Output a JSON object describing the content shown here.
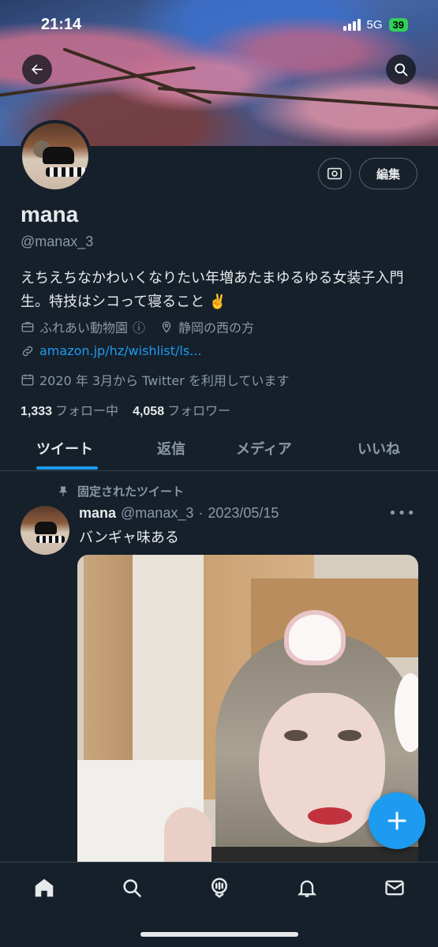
{
  "status_bar": {
    "time": "21:14",
    "network": "5G",
    "battery": "39"
  },
  "header": {
    "edit_label": "編集"
  },
  "profile": {
    "name": "mana",
    "handle": "@manax_3",
    "bio": "えちえちなかわいくなりたい年増あたまゆるゆる女装子入門生。特技はシコって寝ること ✌️",
    "category": "ふれあい動物園",
    "category_info": "ⓘ",
    "location": "静岡の西の方",
    "website": "amazon.jp/hz/wishlist/ls...",
    "joined": "2020 年 3月から Twitter を利用しています",
    "following_count": "1,333",
    "following_label": "フォロー中",
    "followers_count": "4,058",
    "followers_label": "フォロワー"
  },
  "tabs": [
    {
      "label": "ツイート",
      "active": true
    },
    {
      "label": "返信",
      "active": false
    },
    {
      "label": "メディア",
      "active": false
    },
    {
      "label": "いいね",
      "active": false
    }
  ],
  "tweet": {
    "pinned_label": "固定されたツイート",
    "author_name": "mana",
    "author_handle": "@manax_3",
    "separator": "·",
    "date": "2023/05/15",
    "more": "•••",
    "text": "バンギャ味ある"
  },
  "colors": {
    "background": "#15202b",
    "accent": "#1d9bf0",
    "muted": "#8b98a5",
    "text": "#e7e9ea"
  },
  "icons": {
    "back": "back-arrow-icon",
    "search": "search-icon",
    "edit_photo": "photo-frame-icon",
    "briefcase": "briefcase-icon",
    "location": "location-pin-icon",
    "link": "link-icon",
    "calendar": "calendar-icon",
    "pin": "pin-icon",
    "compose": "plus-icon",
    "nav": [
      "home-icon",
      "search-icon",
      "spaces-icon",
      "bell-icon",
      "mail-icon"
    ]
  }
}
